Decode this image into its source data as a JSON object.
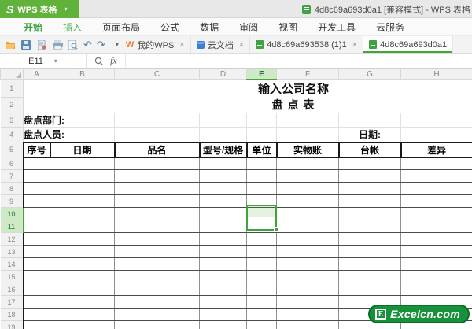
{
  "titlebar": {
    "logo_letter": "S",
    "app_name": "WPS 表格",
    "doc_title": "4d8c69a693d0a1 [兼容模式] - WPS 表格"
  },
  "menubar": {
    "tabs": [
      {
        "label": "开始"
      },
      {
        "label": "插入"
      },
      {
        "label": "页面布局"
      },
      {
        "label": "公式"
      },
      {
        "label": "数据"
      },
      {
        "label": "审阅"
      },
      {
        "label": "视图"
      },
      {
        "label": "开发工具"
      },
      {
        "label": "云服务"
      }
    ]
  },
  "toolbar": {
    "icon_names": [
      "open-folder-icon",
      "save-icon",
      "export-icon",
      "print-icon",
      "print-preview-icon",
      "undo-icon",
      "redo-icon",
      "toolbar-dropdown-icon"
    ],
    "undo_glyph": "↶",
    "redo_glyph": "↷",
    "caret_glyph": "▾",
    "doc_tabs": [
      {
        "label": "我的WPS",
        "close": "×"
      },
      {
        "label": "云文档",
        "close": "×"
      },
      {
        "label": "4d8c69a693538 (1)1",
        "close": "×"
      },
      {
        "label": "4d8c69a693d0a1",
        "close": ""
      }
    ]
  },
  "formula_bar": {
    "name_box": "E11",
    "caret_glyph": "▾",
    "fx_label": "fx",
    "formula_value": ""
  },
  "sheet": {
    "columns": [
      "A",
      "B",
      "C",
      "D",
      "E",
      "F",
      "G",
      "H"
    ],
    "selected_column": "E",
    "row_labels": [
      "1",
      "2",
      "3",
      "4",
      "5"
    ],
    "first_empty_row": 6,
    "last_row": 19,
    "selected_rows": [
      10,
      11
    ],
    "active_cell": "E11",
    "company_title": "输入公司名称",
    "sheet_title": "盘 点 表",
    "dept_label": "盘点部门:",
    "person_label": "盘点人员:",
    "date_label": "日期:",
    "table_headers": [
      "序号",
      "日期",
      "品名",
      "型号/规格",
      "单位",
      "实物账",
      "台帐",
      "差异"
    ]
  },
  "watermark": {
    "badge_letter": "E",
    "site_text": "Excelcn.com"
  },
  "colors": {
    "wps_green": "#61b23a",
    "active_tab_green": "#3ca13c",
    "doc_tab_underline": "#43a533",
    "selection_green": "#3fa33c",
    "header_highlight_bg": "#cfe8c6",
    "logo_green": "#17923b"
  }
}
